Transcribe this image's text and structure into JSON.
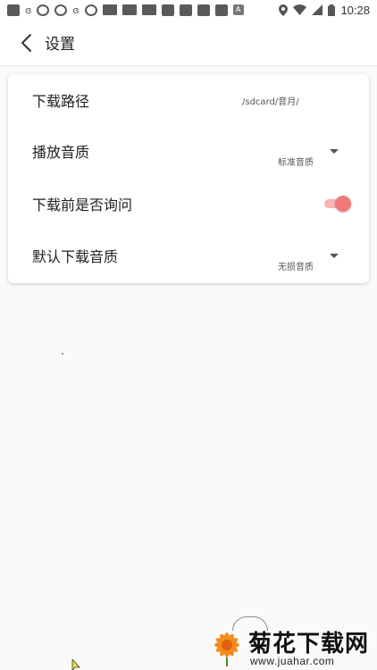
{
  "status_bar": {
    "time": "10:28",
    "left_icons": [
      "stop-icon",
      "app-icon",
      "camera-icon",
      "camera-icon",
      "app-icon",
      "camera-icon",
      "news-icon",
      "news-icon",
      "news-icon",
      "stop-icon",
      "stop-icon",
      "stop-icon",
      "stop-icon",
      "a-icon"
    ],
    "right_icons": [
      "location-icon",
      "wifi-icon",
      "signal-icon",
      "battery-icon"
    ]
  },
  "header": {
    "title": "设置"
  },
  "settings": {
    "download_path": {
      "label": "下载路径",
      "value": "/sdcard/音月/"
    },
    "play_quality": {
      "label": "播放音质",
      "value": "标准音质"
    },
    "ask_before_download": {
      "label": "下载前是否询问",
      "enabled": true
    },
    "default_download_quality": {
      "label": "默认下载音质",
      "value": "无损音质"
    }
  },
  "watermark": {
    "title": "菊花下载网",
    "url": "www.juahar.com"
  },
  "colors": {
    "toggle_on": "#f07a7a",
    "toggle_track": "#f7b4b4",
    "background": "#fafafa",
    "card": "#ffffff"
  }
}
